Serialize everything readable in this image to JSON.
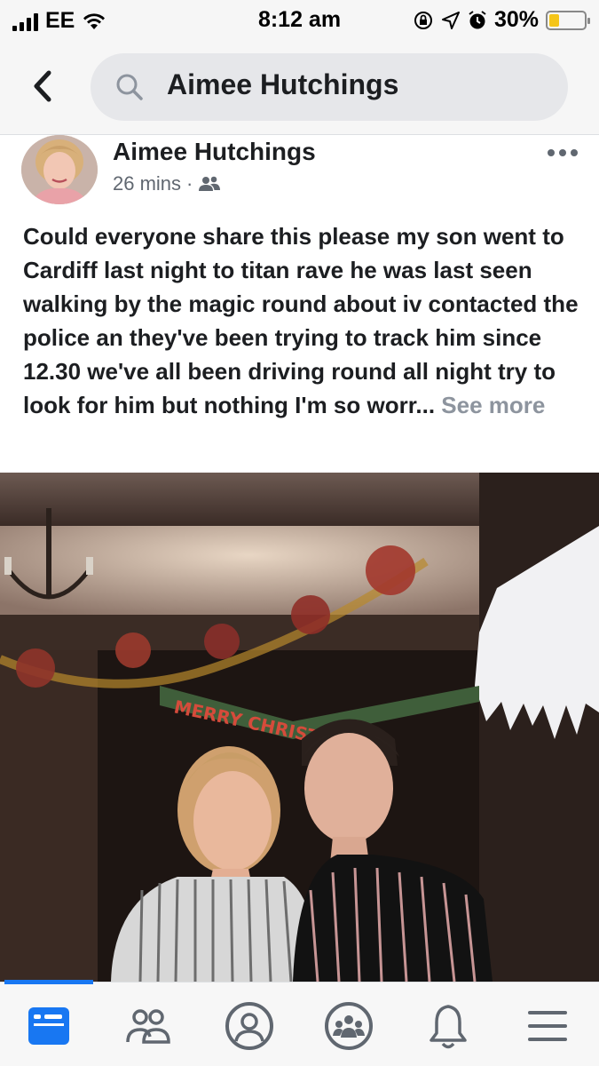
{
  "status_bar": {
    "carrier": "EE",
    "time": "8:12 am",
    "battery_percent": "30%",
    "battery_level": 0.3,
    "icons": [
      "signal-icon",
      "wifi-icon",
      "orientation-lock-icon",
      "location-icon",
      "alarm-icon",
      "battery-icon"
    ]
  },
  "header": {
    "back_icon": "chevron-left-icon",
    "search_icon": "search-icon",
    "search_value": "Aimee Hutchings"
  },
  "post": {
    "author": "Aimee Hutchings",
    "time": "26 mins",
    "separator": "·",
    "audience_icon": "friends-icon",
    "more_icon": "more-dots-icon",
    "text": "Could everyone share this please my son went to Cardiff last night to titan rave he was last seen walking by the magic round about iv contacted the police an they've been trying to track him since 12.30 we've all  been driving round all night try to look for him but nothing I'm so worr...",
    "see_more": "See more",
    "photo_banner_text": "MERRY CHRISTMAS"
  },
  "bottom_nav": {
    "items": [
      {
        "name": "news-feed",
        "icon": "news-feed-icon",
        "active": true
      },
      {
        "name": "friends",
        "icon": "friends-icon",
        "active": false
      },
      {
        "name": "profile",
        "icon": "profile-icon",
        "active": false
      },
      {
        "name": "groups",
        "icon": "groups-icon",
        "active": false
      },
      {
        "name": "notifications",
        "icon": "bell-icon",
        "active": false
      },
      {
        "name": "menu",
        "icon": "menu-icon",
        "active": false
      }
    ],
    "accent_color": "#1877f2"
  }
}
